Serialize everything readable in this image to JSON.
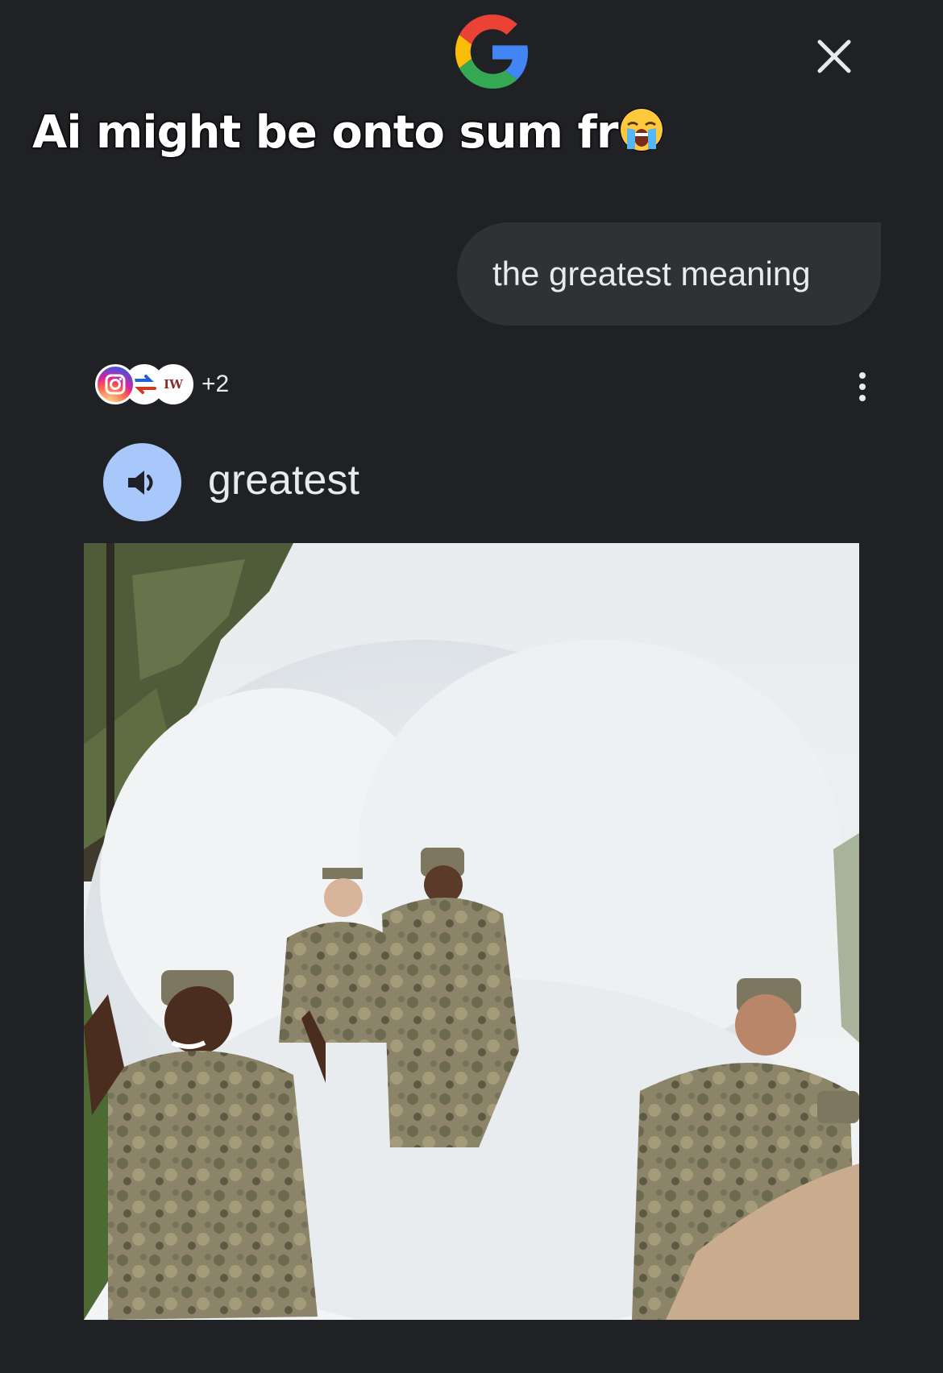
{
  "caption": {
    "text": "Ai might be onto sum fr",
    "emoji": "loudly-crying-face"
  },
  "header": {
    "logo": "google-g-logo",
    "close_icon": "close-icon"
  },
  "query": {
    "text": "the greatest meaning"
  },
  "sources": {
    "icons": [
      "instagram-icon",
      "source-icon",
      "source-icon"
    ],
    "source_3_letters": "IW",
    "extra_count": "+2"
  },
  "result": {
    "word": "greatest",
    "speaker_icon": "speaker-icon",
    "more_icon": "more-vert-icon",
    "image": "soldiers-in-white-smoke-photo"
  },
  "colors": {
    "background": "#202125",
    "bubble": "#303134",
    "speaker_button": "#a8c7fa",
    "text": "#e8eaed"
  }
}
